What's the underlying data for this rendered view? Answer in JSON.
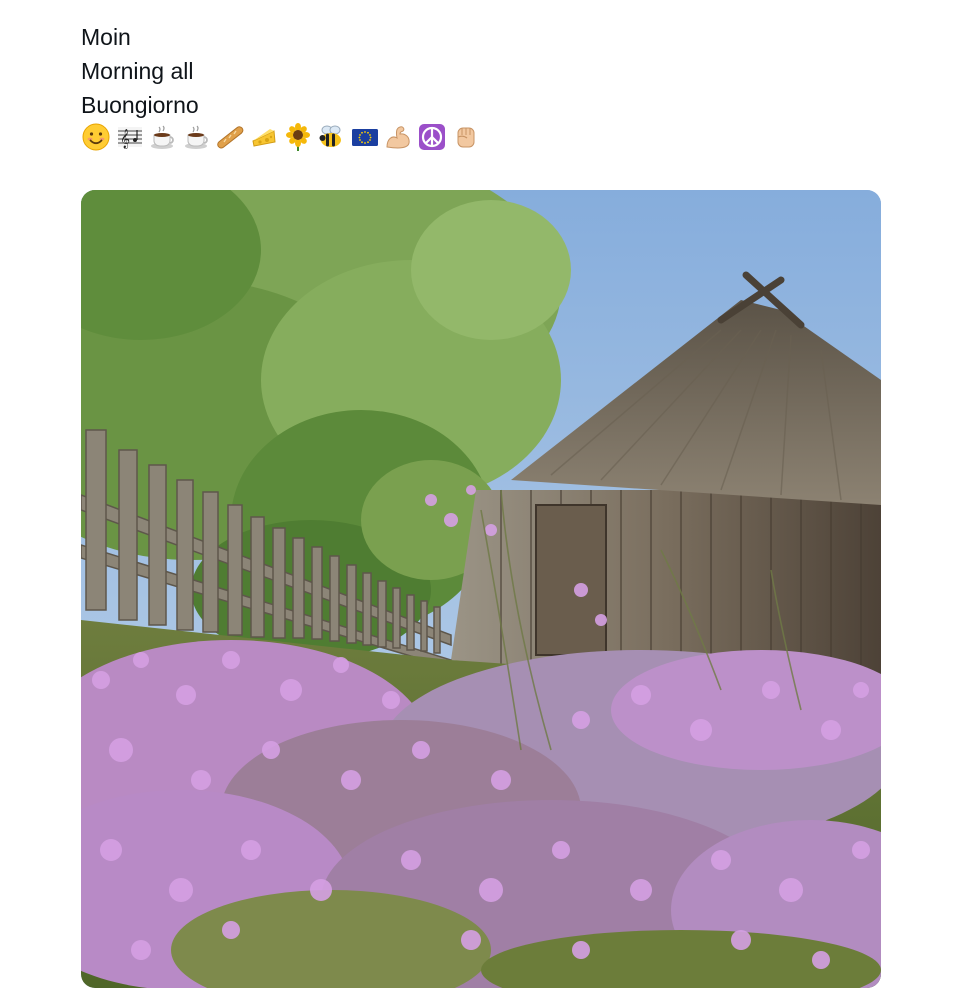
{
  "post": {
    "lines": [
      "Moin",
      "Morning all",
      "Buongiorno"
    ],
    "emojis": [
      "smiling-face-icon",
      "musical-score-icon",
      "coffee-cup-icon",
      "coffee-cup-icon",
      "baguette-icon",
      "cheese-icon",
      "sunflower-icon",
      "bee-icon",
      "eu-flag-icon",
      "flexed-biceps-icon",
      "peace-symbol-icon",
      "raised-fist-icon"
    ]
  },
  "media": {
    "kind": "photo",
    "subject": "thatched-barn-with-heather"
  },
  "colors": {
    "text": "#0f1419",
    "background": "#ffffff",
    "sky": "#8fb5de",
    "heather": "#c48ad6",
    "tree": "#6f9a45",
    "roof": "#7d7466",
    "wood": "#6e6253"
  }
}
